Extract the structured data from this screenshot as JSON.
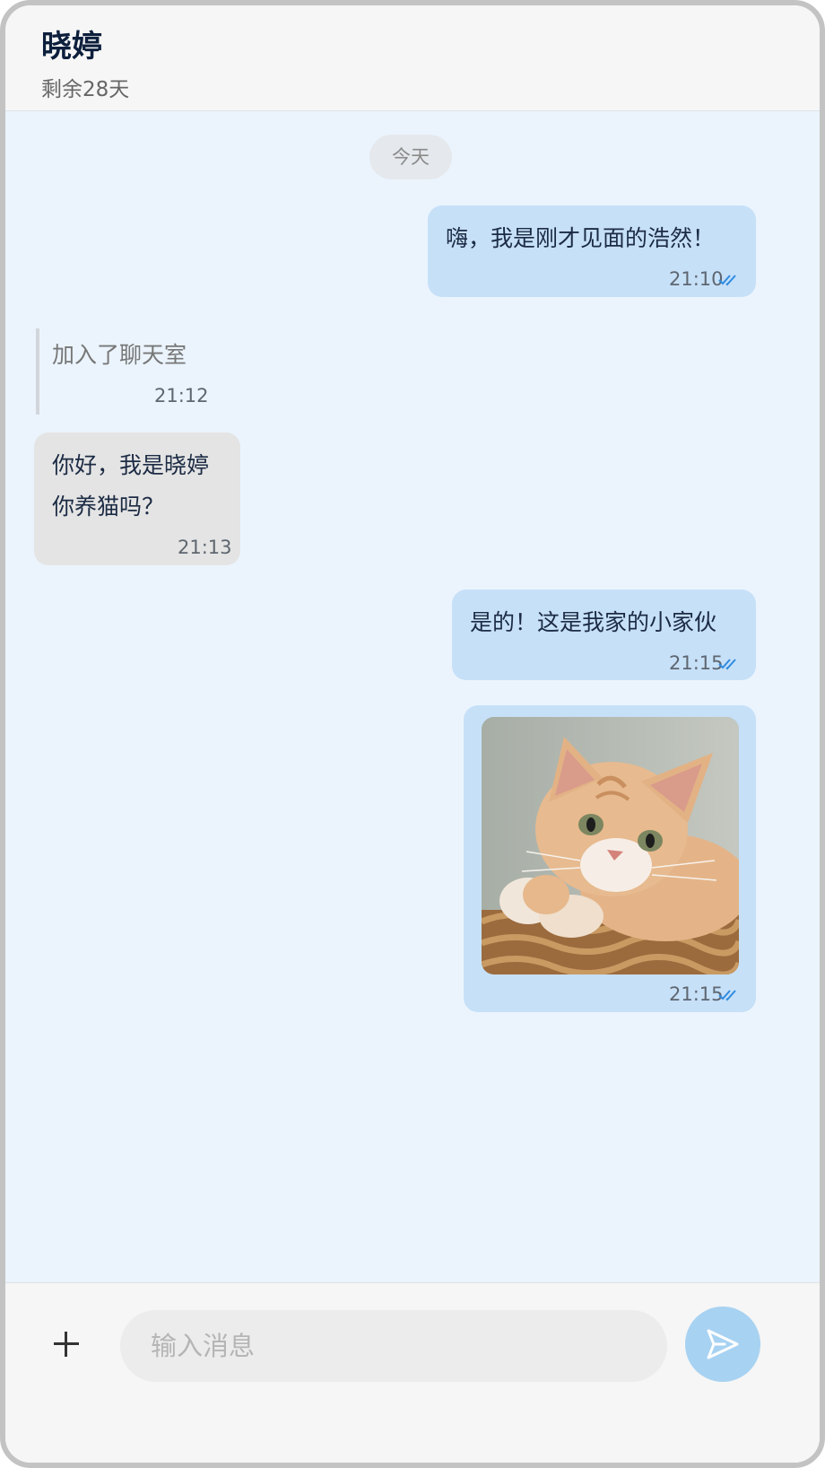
{
  "header": {
    "title": "晓婷",
    "subtitle": "剩余28天"
  },
  "date_divider": "今天",
  "messages": [
    {
      "type": "outgoing",
      "text": "嗨，我是刚才见面的浩然！",
      "time": "21:10",
      "status": "read"
    },
    {
      "type": "system",
      "text": "加入了聊天室",
      "time": "21:12"
    },
    {
      "type": "incoming",
      "lines": [
        "你好，我是晓婷",
        "你养猫吗？"
      ],
      "time": "21:13"
    },
    {
      "type": "outgoing",
      "text": "是的！这是我家的小家伙",
      "time": "21:15",
      "status": "read"
    },
    {
      "type": "outgoing-image",
      "image": "cat-photo",
      "time": "21:15",
      "status": "read"
    }
  ],
  "composer": {
    "placeholder": "输入消息",
    "add_icon": "plus-icon",
    "send_icon": "send-icon"
  },
  "colors": {
    "chat_background": "#ebf4fd",
    "outgoing_bubble": "#c6e0f8",
    "incoming_bubble": "#e4e4e4",
    "read_check": "#2f8be0",
    "send_button": "#a8d2f2"
  }
}
